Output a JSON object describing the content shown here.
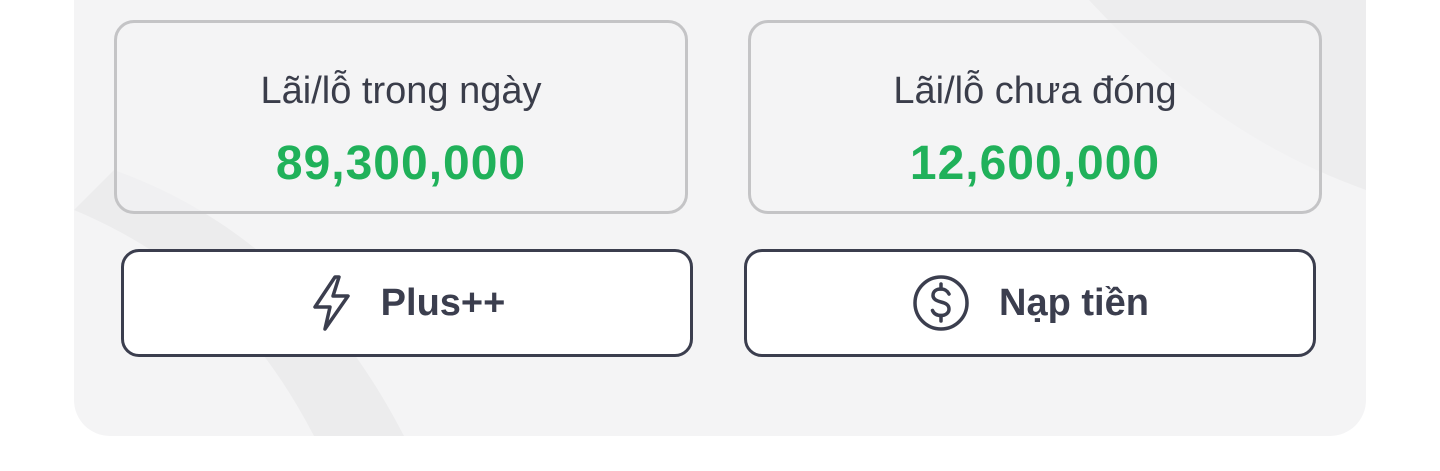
{
  "stats": {
    "daily_pnl": {
      "label": "Lãi/lỗ trong ngày",
      "value": "89,300,000"
    },
    "unrealized_pnl": {
      "label": "Lãi/lỗ chưa đóng",
      "value": "12,600,000"
    }
  },
  "actions": {
    "plus": {
      "label": "Plus++",
      "icon": "lightning-icon"
    },
    "deposit": {
      "label": "Nạp tiền",
      "icon": "dollar-circle-icon"
    }
  },
  "colors": {
    "positive": "#20b15a",
    "text": "#3a3d4a",
    "button_border": "#3b3e4e",
    "card_border": "#c4c4c6",
    "panel_background": "#f4f4f5"
  }
}
